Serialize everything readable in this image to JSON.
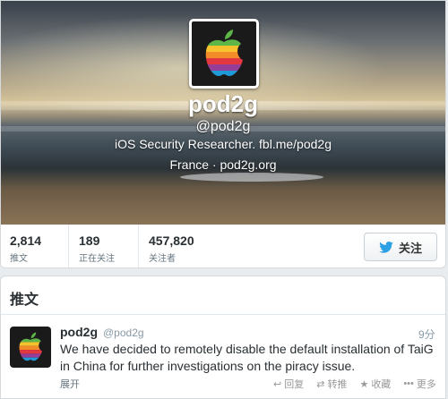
{
  "profile": {
    "name": "pod2g",
    "handle": "@pod2g",
    "bio": "iOS Security Researcher. fbl.me/pod2g",
    "location": "France · pod2g.org"
  },
  "stats": [
    {
      "value": "2,814",
      "label": "推文"
    },
    {
      "value": "189",
      "label": "正在关注"
    },
    {
      "value": "457,820",
      "label": "关注者"
    }
  ],
  "follow_button": {
    "label": "关注",
    "icon": "twitter-bird-icon"
  },
  "tweets": {
    "title": "推文",
    "items": [
      {
        "name": "pod2g",
        "handle": "@pod2g",
        "time": "9分",
        "text": "We have decided to remotely disable the default installation of TaiG in China for further investigations on the piracy issue.",
        "expand": "展开",
        "actions": {
          "reply": "回复",
          "retweet": "转推",
          "favorite": "收藏",
          "more": "更多"
        }
      }
    ]
  },
  "colors": {
    "accent": "#2ba0e5",
    "text": "#292f33",
    "muted": "#8899a6"
  }
}
